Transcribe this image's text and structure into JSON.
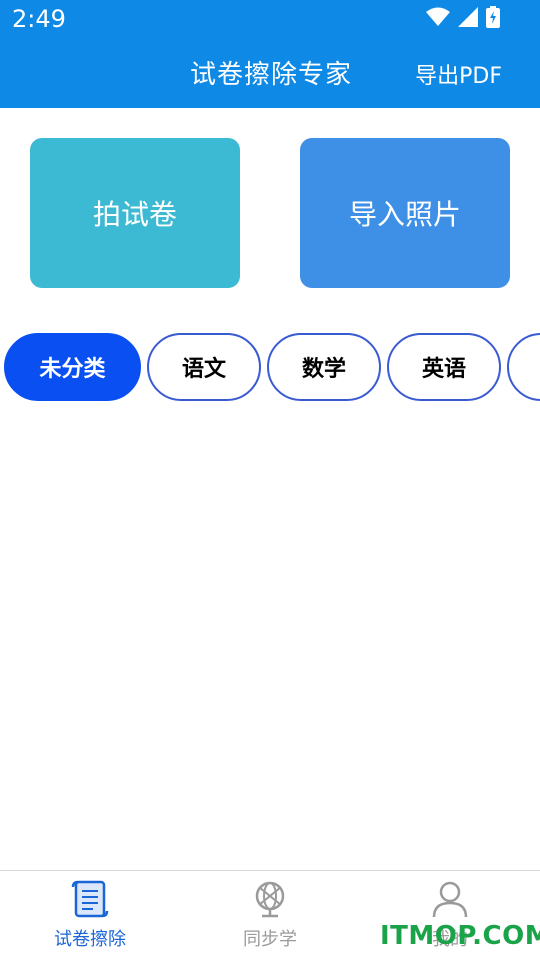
{
  "status_bar": {
    "time": "2:49"
  },
  "header": {
    "title": "试卷擦除专家",
    "export_label": "导出PDF"
  },
  "actions": {
    "take_photo_label": "拍试卷",
    "import_label": "导入照片"
  },
  "categories": {
    "items": [
      "未分类",
      "语文",
      "数学",
      "英语"
    ],
    "selected": "未分类"
  },
  "tabbar": {
    "items": [
      {
        "label": "试卷擦除",
        "icon": "scroll-icon",
        "active": true
      },
      {
        "label": "同步学",
        "icon": "globe-icon",
        "active": false
      },
      {
        "label": "我的",
        "icon": "user-icon",
        "active": false
      }
    ]
  },
  "watermark": {
    "text": "ITMOP.COM"
  },
  "colors": {
    "header": "#0f89e6",
    "card_photo": "#3cb9d3",
    "card_import": "#3d90e6",
    "chip_active": "#0a4ff2",
    "chip_border": "#3a5ad2",
    "tab_active": "#1b66d6",
    "tab_inactive": "#9a9a9a",
    "watermark": "#1ba34a"
  }
}
